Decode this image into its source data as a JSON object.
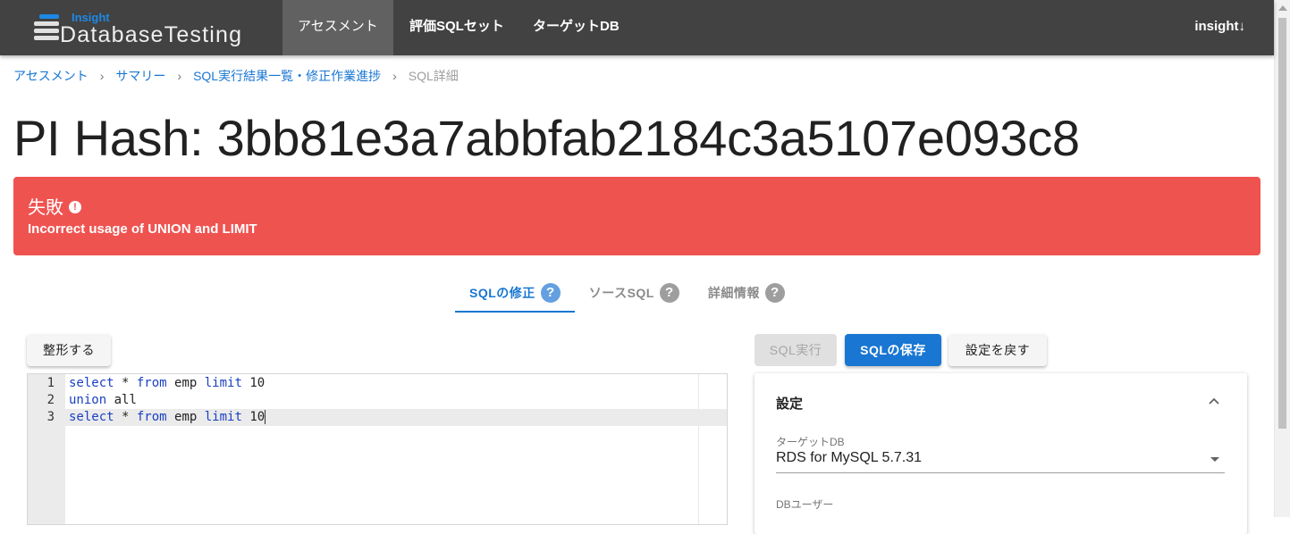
{
  "app": {
    "logo_small": "Insight",
    "logo_big": "DatabaseTesting"
  },
  "nav": {
    "tabs": [
      {
        "label": "アセスメント"
      },
      {
        "label": "評価SQLセット"
      },
      {
        "label": "ターゲットDB"
      }
    ],
    "user": "insight↓"
  },
  "breadcrumb": [
    {
      "label": "アセスメント"
    },
    {
      "label": "サマリー"
    },
    {
      "label": "SQL実行結果一覧・修正作業進捗"
    },
    {
      "label": "SQL詳細"
    }
  ],
  "breadcrumb_sep": "›",
  "title": "PI Hash: 3bb81e3a7abbfab2184c3a5107e093c8",
  "alert": {
    "status": "失敗",
    "info_icon": "!",
    "message": "Incorrect usage of UNION and LIMIT",
    "color": "#ef5350"
  },
  "tabs": [
    {
      "label": "SQLの修正",
      "help": "?"
    },
    {
      "label": "ソースSQL",
      "help": "?"
    },
    {
      "label": "詳細情報",
      "help": "?"
    }
  ],
  "buttons": {
    "format": "整形する",
    "run_sql": "SQL実行",
    "save_sql": "SQLの保存",
    "reset_settings": "設定を戻す"
  },
  "editor": {
    "lines": [
      {
        "no": "1",
        "tokens": [
          [
            "kw",
            "select"
          ],
          [
            "t",
            " * "
          ],
          [
            "kw",
            "from"
          ],
          [
            "t",
            " emp "
          ],
          [
            "kw",
            "limit"
          ],
          [
            "t",
            " 10"
          ]
        ]
      },
      {
        "no": "2",
        "tokens": [
          [
            "kw",
            "union"
          ],
          [
            "t",
            " all"
          ]
        ]
      },
      {
        "no": "3",
        "tokens": [
          [
            "kw",
            "select"
          ],
          [
            "t",
            " * "
          ],
          [
            "kw",
            "from"
          ],
          [
            "t",
            " emp "
          ],
          [
            "kw",
            "limit"
          ],
          [
            "t",
            " 10"
          ]
        ]
      }
    ],
    "active_line": 3
  },
  "settings": {
    "title": "設定",
    "target_db_label": "ターゲットDB",
    "target_db_value": "RDS for MySQL 5.7.31",
    "db_user_label": "DBユーザー"
  },
  "colors": {
    "navbar": "#424242",
    "primary": "#1976d2",
    "error": "#ef5350"
  }
}
